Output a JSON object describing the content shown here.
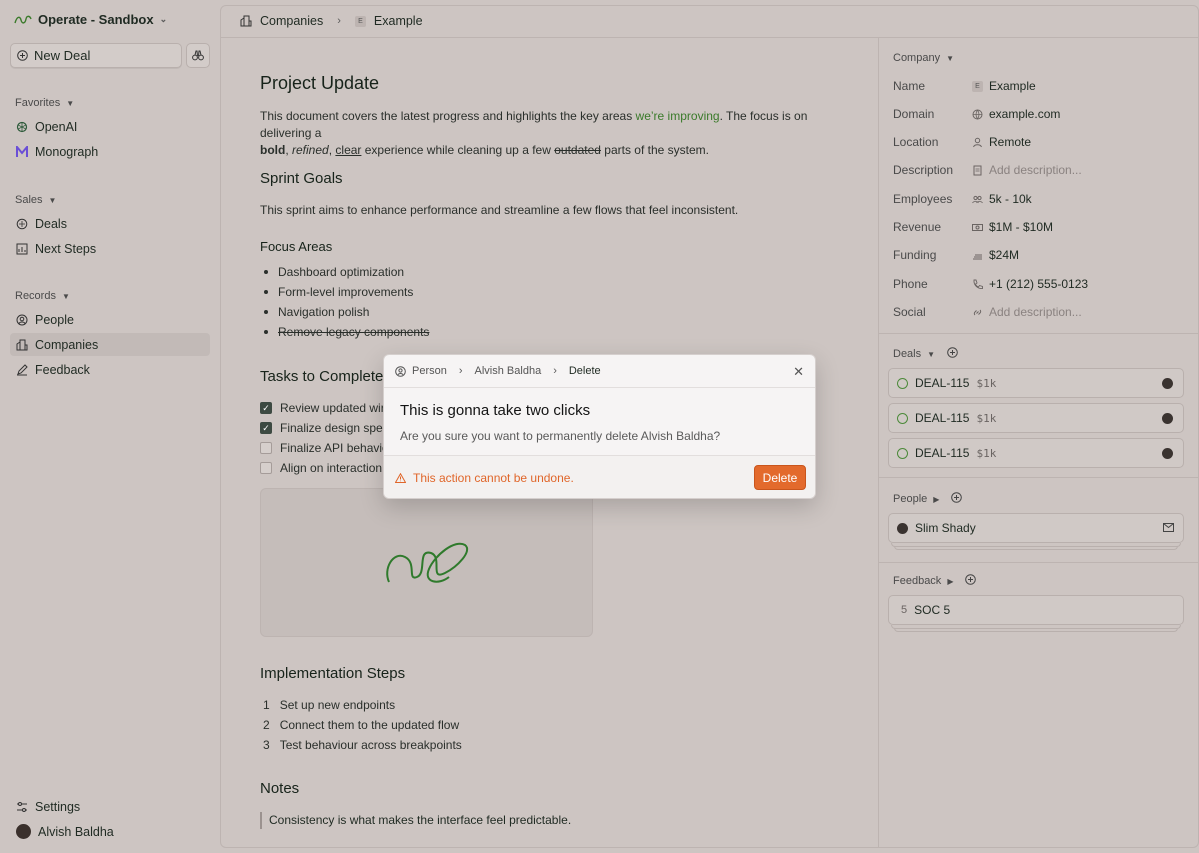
{
  "workspace": {
    "name": "Operate - Sandbox"
  },
  "sidebar": {
    "new_deal": "New Deal",
    "favorites": {
      "title": "Favorites",
      "items": [
        {
          "label": "OpenAI"
        },
        {
          "label": "Monograph"
        }
      ]
    },
    "sales": {
      "title": "Sales",
      "items": [
        {
          "label": "Deals"
        },
        {
          "label": "Next Steps"
        }
      ]
    },
    "records": {
      "title": "Records",
      "items": [
        {
          "label": "People"
        },
        {
          "label": "Companies"
        },
        {
          "label": "Feedback"
        }
      ]
    },
    "settings": "Settings",
    "user": "Alvish Baldha"
  },
  "breadcrumb": {
    "root": "Companies",
    "badge": "E",
    "current": "Example"
  },
  "doc": {
    "title": "Project Update",
    "intro_1": "This document covers the latest progress and highlights the key areas ",
    "intro_link": "we’re improving",
    "intro_2": ". The focus is on delivering a",
    "intro_bold": "bold",
    "intro_comma1": ",",
    "intro_italic": "refined",
    "intro_comma2": ",",
    "intro_under": "clear",
    "intro_3": " experience while cleaning up a few ",
    "intro_strike": "outdated",
    "intro_4": " parts of the system.",
    "sprint_title": "Sprint Goals",
    "sprint_text": "This sprint aims to enhance performance and streamline a few flows that feel inconsistent.",
    "focus_title": "Focus Areas",
    "focus_items": [
      "Dashboard optimization",
      "Form-level improvements",
      "Navigation polish",
      "Remove legacy components"
    ],
    "tasks_title": "Tasks to Complete",
    "tasks": [
      {
        "label": "Review updated wire",
        "done": true
      },
      {
        "label": "Finalize design specs",
        "done": true
      },
      {
        "label": "Finalize API behaviou",
        "done": false
      },
      {
        "label": "Align on interaction c",
        "done": false
      }
    ],
    "impl_title": "Implementation Steps",
    "steps": [
      {
        "n": "1",
        "label": "Set up new endpoints"
      },
      {
        "n": "2",
        "label": "Connect them to the updated flow"
      },
      {
        "n": "3",
        "label": "Test behaviour across breakpoints"
      }
    ],
    "notes_title": "Notes",
    "quote": "Consistency is what makes the interface feel predictable."
  },
  "company": {
    "section": "Company",
    "props": [
      {
        "label": "Name",
        "value": "Example",
        "icon": "e-badge",
        "placeholder": false
      },
      {
        "label": "Domain",
        "value": "example.com",
        "icon": "globe-icon",
        "placeholder": false
      },
      {
        "label": "Location",
        "value": "Remote",
        "icon": "person-icon",
        "placeholder": false
      },
      {
        "label": "Description",
        "value": "Add description...",
        "icon": "doc-icon",
        "placeholder": true
      },
      {
        "label": "Employees",
        "value": "5k - 10k",
        "icon": "people-icon",
        "placeholder": false
      },
      {
        "label": "Revenue",
        "value": "$1M - $10M",
        "icon": "cash-icon",
        "placeholder": false
      },
      {
        "label": "Funding",
        "value": "$24M",
        "icon": "coins-icon",
        "placeholder": false
      },
      {
        "label": "Phone",
        "value": "+1 (212) 555-0123",
        "icon": "phone-icon",
        "placeholder": false
      },
      {
        "label": "Social",
        "value": "Add description...",
        "icon": "link-icon",
        "placeholder": true
      }
    ]
  },
  "deals": {
    "section": "Deals",
    "items": [
      {
        "name": "DEAL-115",
        "amount": "$1k"
      },
      {
        "name": "DEAL-115",
        "amount": "$1k"
      },
      {
        "name": "DEAL-115",
        "amount": "$1k"
      }
    ]
  },
  "people": {
    "section": "People",
    "item": "Slim Shady"
  },
  "feedback": {
    "section": "Feedback",
    "badge": "5",
    "item": "SOC 5"
  },
  "modal": {
    "crumb_1": "Person",
    "crumb_2": "Alvish Baldha",
    "crumb_3": "Delete",
    "title": "This is gonna take two clicks",
    "subtitle": "Are you sure you want to permanently delete Alvish Baldha?",
    "warning": "This action cannot be undone.",
    "delete_label": "Delete"
  },
  "colors": {
    "accent_green": "#3a7a2a",
    "danger": "#e36a2c",
    "warning_text": "#e0662a"
  }
}
